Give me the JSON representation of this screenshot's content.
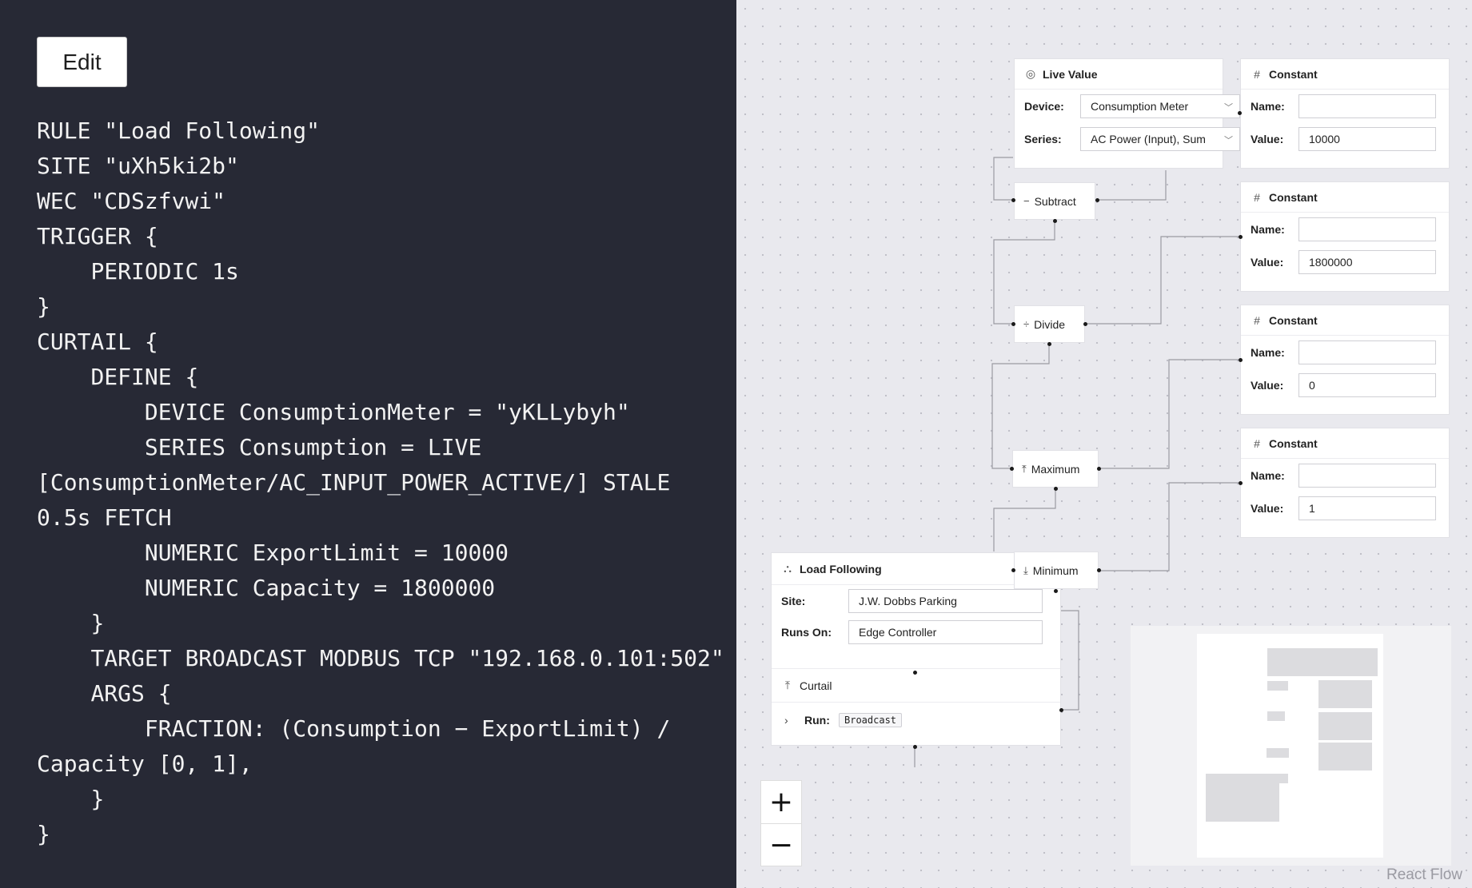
{
  "editor": {
    "edit_label": "Edit",
    "code": "RULE \"Load Following\"\nSITE \"uXh5ki2b\"\nWEC \"CDSzfvwi\"\nTRIGGER {\n    PERIODIC 1s\n}\nCURTAIL {\n    DEFINE {\n        DEVICE ConsumptionMeter = \"yKLLybyh\"\n        SERIES Consumption = LIVE [ConsumptionMeter/AC_INPUT_POWER_ACTIVE/] STALE 0.5s FETCH\n        NUMERIC ExportLimit = 10000\n        NUMERIC Capacity = 1800000\n    }\n    TARGET BROADCAST MODBUS TCP \"192.168.0.101:502\"\n    ARGS {\n        FRACTION: (Consumption − ExportLimit) / Capacity [0, 1],\n    }\n}"
  },
  "flow": {
    "live_value": {
      "title": "Live Value",
      "icon": "target-icon",
      "device_label": "Device:",
      "device_value": "Consumption Meter",
      "series_label": "Series:",
      "series_value": "AC Power (Input), Sum"
    },
    "constants": [
      {
        "title": "Constant",
        "name_label": "Name:",
        "name_value": "",
        "value_label": "Value:",
        "value": "10000"
      },
      {
        "title": "Constant",
        "name_label": "Name:",
        "name_value": "",
        "value_label": "Value:",
        "value": "1800000"
      },
      {
        "title": "Constant",
        "name_label": "Name:",
        "name_value": "",
        "value_label": "Value:",
        "value": "0"
      },
      {
        "title": "Constant",
        "name_label": "Name:",
        "name_value": "",
        "value_label": "Value:",
        "value": "1"
      }
    ],
    "operators": {
      "subtract": {
        "label": "Subtract",
        "symbol": "−"
      },
      "divide": {
        "label": "Divide",
        "symbol": "÷"
      },
      "maximum": {
        "label": "Maximum",
        "symbol": "⤒"
      },
      "minimum": {
        "label": "Minimum",
        "symbol": "⤓"
      }
    },
    "rule": {
      "title": "Load Following",
      "site_label": "Site:",
      "site_value": "J.W. Dobbs Parking",
      "runs_on_label": "Runs On:",
      "runs_on_value": "Edge Controller",
      "curtail_label": "Curtail",
      "run_label": "Run:",
      "run_value": "Broadcast"
    },
    "zoom": {
      "in": "+",
      "out": "−"
    },
    "attribution": "React Flow"
  }
}
